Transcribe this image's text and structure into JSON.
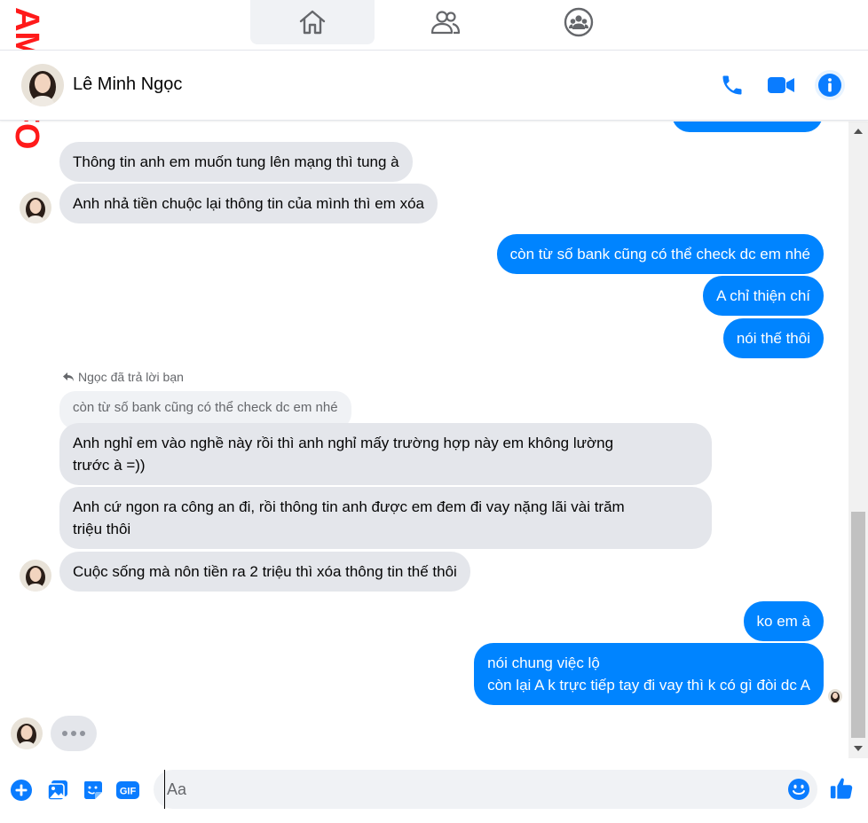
{
  "watermark": {
    "text": "AM.INFO"
  },
  "contact": {
    "name": "Lê Minh Ngọc"
  },
  "messages": [
    {
      "side": "in",
      "text": "Thông tin anh em muốn tung lên mạng thì tung à"
    },
    {
      "side": "in",
      "text": "Anh nhả tiền chuộc lại thông tin của mình thì em xóa"
    },
    {
      "side": "out",
      "text": "còn từ số bank cũng có thể check dc em nhé"
    },
    {
      "side": "out",
      "text": "A chỉ thiện chí"
    },
    {
      "side": "out",
      "text": "nói thế thôi"
    },
    {
      "side": "in",
      "text": "Anh nghỉ em vào nghề này rồi thì anh nghỉ mấy trường hợp này em không lường\ntrước à =))"
    },
    {
      "side": "in",
      "text": "Anh cứ ngon ra công an đi, rồi thông tin anh được em đem đi vay nặng lãi vài trăm\ntriệu thôi"
    },
    {
      "side": "in",
      "text": "Cuộc sống mà nôn tiền ra 2 triệu thì xóa thông tin thế thôi"
    },
    {
      "side": "out",
      "text": "ko em à"
    },
    {
      "side": "out",
      "text": "nói chung việc lộ\ncòn lại A k trực tiếp tay đi vay thì k có gì đòi dc A"
    }
  ],
  "reply": {
    "label": "Ngọc đã trả lời bạn",
    "quote": "còn từ số bank cũng có thể check dc em nhé"
  },
  "composer": {
    "placeholder": "Aa",
    "gif_label": "GIF"
  },
  "colors": {
    "accent": "#0084ff",
    "incoming": "#e4e6eb",
    "icon": "#0a7cff"
  },
  "icons": [
    "home-icon",
    "people-icon",
    "groups-icon",
    "phone-icon",
    "video-icon",
    "info-icon",
    "plus-icon",
    "photo-icon",
    "sticker-icon",
    "gif-icon",
    "emoji-icon",
    "like-icon"
  ]
}
